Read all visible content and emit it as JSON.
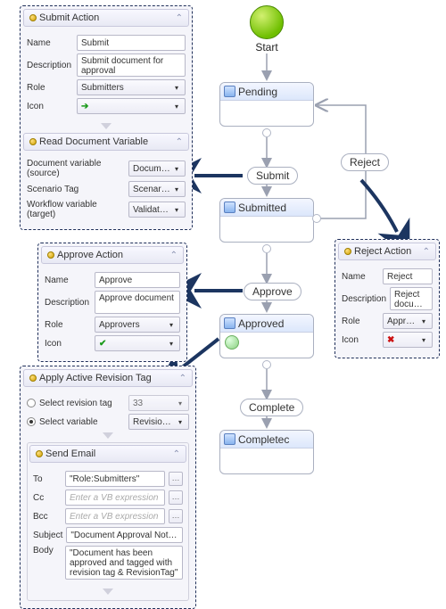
{
  "colors": {
    "arrow_blue": "#1c3560",
    "flow_gray": "#b6b9c2",
    "flow_dark": "#7b829a"
  },
  "start": {
    "label": "Start"
  },
  "states": {
    "pending": {
      "title": "Pending"
    },
    "submitted": {
      "title": "Submitted"
    },
    "approved": {
      "title": "Approved"
    },
    "completed": {
      "title": "Completec"
    }
  },
  "transitions": {
    "submit": {
      "label": "Submit"
    },
    "reject": {
      "label": "Reject"
    },
    "approve": {
      "label": "Approve"
    },
    "complete": {
      "label": "Complete"
    }
  },
  "panels": {
    "submitAction": {
      "title": "Submit Action",
      "fields": {
        "name_label": "Name",
        "name_value": "Submit",
        "desc_label": "Description",
        "desc_value": "Submit document for approval",
        "role_label": "Role",
        "role_value": "Submitters",
        "icon_label": "Icon",
        "icon_glyph": "➔"
      }
    },
    "readDocVar": {
      "title": "Read Document Variable",
      "fields": {
        "docvar_label": "Document variable (source)",
        "docvar_value": "DocumentVariable",
        "scenario_label": "Scenario Tag",
        "scenario_value": "ScenarioVariable",
        "wfvar_label": "Workflow variable (target)",
        "wfvar_value": "ValidationVariable"
      }
    },
    "approveAction": {
      "title": "Approve Action",
      "fields": {
        "name_label": "Name",
        "name_value": "Approve",
        "desc_label": "Description",
        "desc_value": "Approve document",
        "role_label": "Role",
        "role_value": "Approvers",
        "icon_label": "Icon",
        "icon_glyph": "✔"
      }
    },
    "rejectAction": {
      "title": "Reject Action",
      "fields": {
        "name_label": "Name",
        "name_value": "Reject",
        "desc_label": "Description",
        "desc_value": "Reject document",
        "role_label": "Role",
        "role_value": "Approvers",
        "icon_label": "Icon",
        "icon_glyph": "✖"
      }
    },
    "applyRevTag": {
      "title": "Apply Active Revision Tag",
      "fields": {
        "opt_tag_label": "Select revision tag",
        "opt_tag_value": "33",
        "opt_var_label": "Select variable",
        "opt_var_value": "RevisionTag"
      }
    },
    "sendEmail": {
      "title": "Send Email",
      "fields": {
        "to_label": "To",
        "to_value": "\"Role:Submitters\"",
        "cc_label": "Cc",
        "cc_placeholder": "Enter a VB expression",
        "bcc_label": "Bcc",
        "bcc_placeholder": "Enter a VB expression",
        "subject_label": "Subject",
        "subject_value": "\"Document Approval Notification\"",
        "body_label": "Body",
        "body_value": "\"Document has been approved and tagged  with revision tag & RevisionTag\""
      }
    }
  }
}
